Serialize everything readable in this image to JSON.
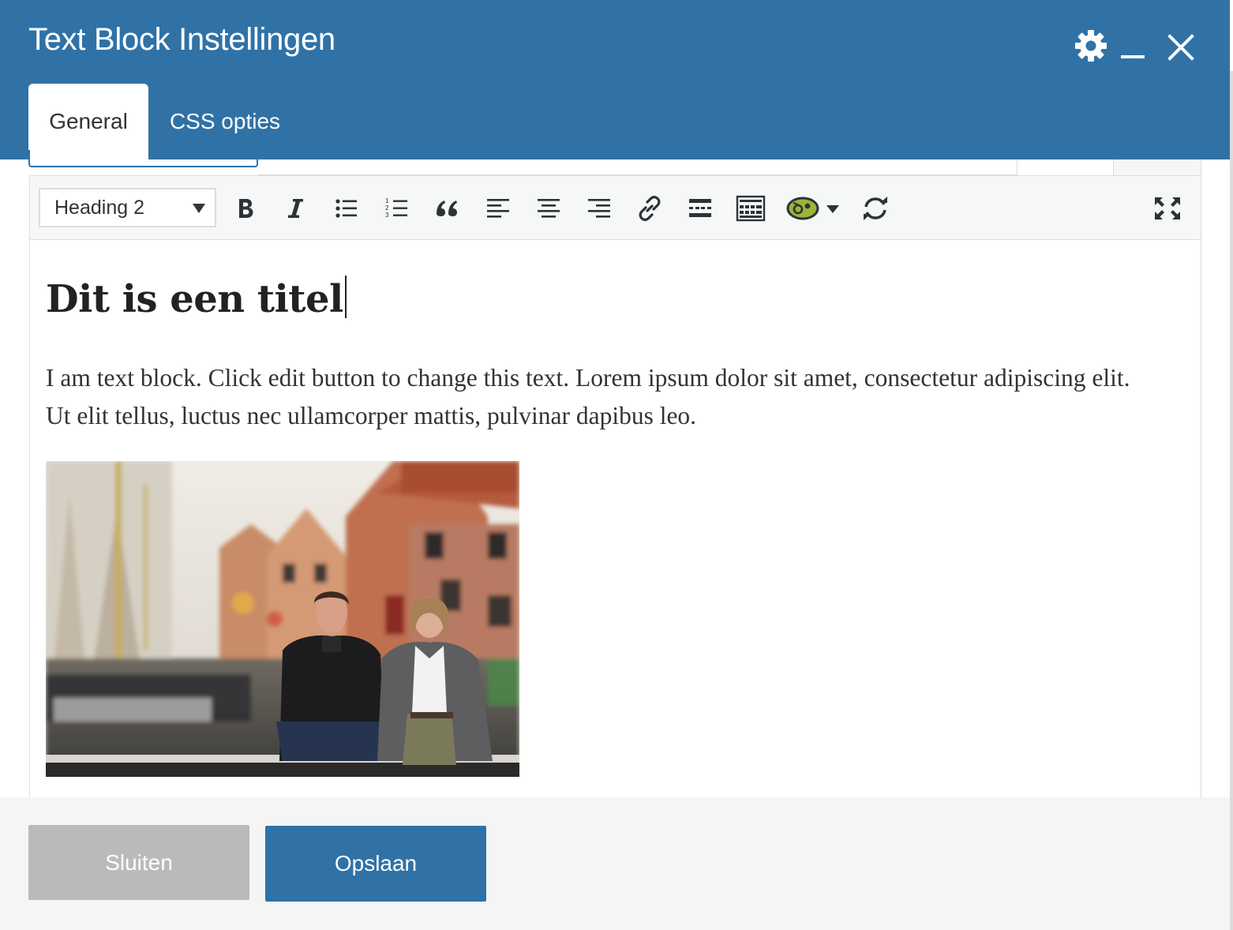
{
  "window": {
    "title": "Text Block Instellingen"
  },
  "tabs": [
    {
      "label": "General",
      "active": true
    },
    {
      "label": "CSS opties",
      "active": false
    }
  ],
  "header_icons": [
    "gear-icon",
    "minimize-icon",
    "close-icon"
  ],
  "toolbar": {
    "format_value": "Heading 2",
    "buttons": [
      "bold-icon",
      "italic-icon",
      "bulleted-list-icon",
      "numbered-list-icon",
      "blockquote-icon",
      "align-left-icon",
      "align-center-icon",
      "align-right-icon",
      "link-icon",
      "read-more-icon",
      "toolbar-toggle-icon",
      "plugin-icon",
      "dropdown-arrow-icon",
      "refresh-icon",
      "fullscreen-icon"
    ]
  },
  "content": {
    "heading": "Dit is een titel",
    "paragraph": "I am text block. Click edit button to change this text. Lorem ipsum dolor sit amet, consectetur adipiscing elit. Ut elit tellus, luctus nec ullamcorper mattis, pulvinar dapibus leo."
  },
  "footer": {
    "close_label": "Sluiten",
    "save_label": "Opslaan"
  },
  "colors": {
    "brand": "#3072a6",
    "close_button": "#bababa",
    "footer_bg": "#f5f5f5",
    "toolbar_bg": "#f6f7f7",
    "plugin_icon_fill": "#9bb43a"
  }
}
